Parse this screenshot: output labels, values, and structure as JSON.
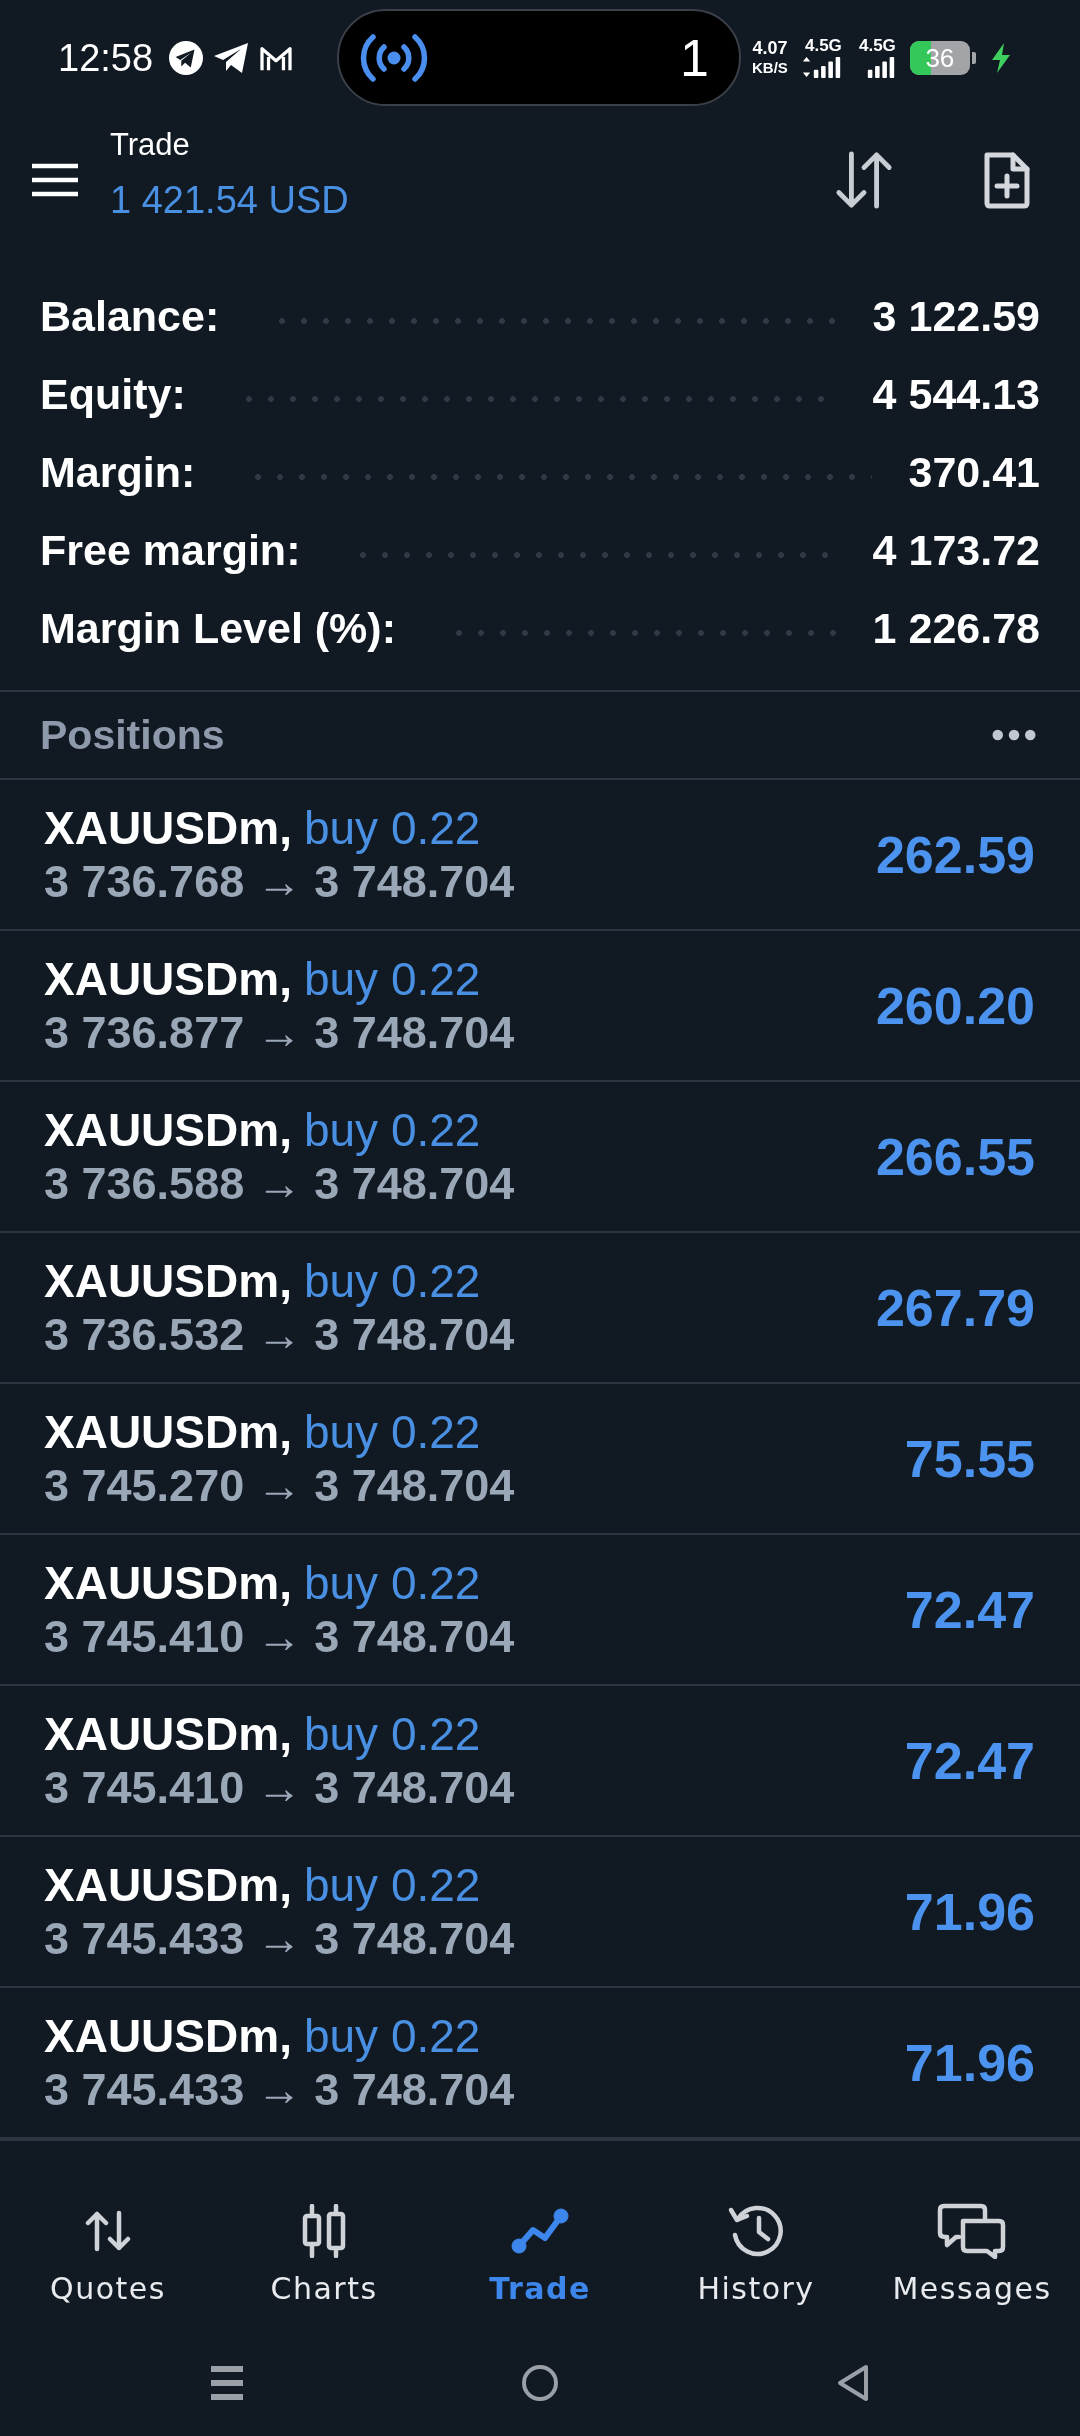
{
  "status_bar": {
    "time": "12:58",
    "island_count": "1",
    "net_speed": "4.07",
    "net_unit": "KB/S",
    "network_labels": [
      "4.5G",
      "4.5G"
    ],
    "battery": "36",
    "charging": true
  },
  "header": {
    "title": "Trade",
    "amount": "1 421.54 USD"
  },
  "account": [
    {
      "label": "Balance:",
      "value": "3 122.59"
    },
    {
      "label": "Equity:",
      "value": "4 544.13"
    },
    {
      "label": "Margin:",
      "value": "370.41"
    },
    {
      "label": "Free margin:",
      "value": "4 173.72"
    },
    {
      "label": "Margin Level (%):",
      "value": "1 226.78"
    }
  ],
  "positions_header": {
    "title": "Positions"
  },
  "positions": [
    {
      "symbol": "XAUUSDm,",
      "order": "buy 0.22",
      "prices": "3 736.768 → 3 748.704",
      "profit": "262.59"
    },
    {
      "symbol": "XAUUSDm,",
      "order": "buy 0.22",
      "prices": "3 736.877 → 3 748.704",
      "profit": "260.20"
    },
    {
      "symbol": "XAUUSDm,",
      "order": "buy 0.22",
      "prices": "3 736.588 → 3 748.704",
      "profit": "266.55"
    },
    {
      "symbol": "XAUUSDm,",
      "order": "buy 0.22",
      "prices": "3 736.532 → 3 748.704",
      "profit": "267.79"
    },
    {
      "symbol": "XAUUSDm,",
      "order": "buy 0.22",
      "prices": "3 745.270 → 3 748.704",
      "profit": "75.55"
    },
    {
      "symbol": "XAUUSDm,",
      "order": "buy 0.22",
      "prices": "3 745.410 → 3 748.704",
      "profit": "72.47"
    },
    {
      "symbol": "XAUUSDm,",
      "order": "buy 0.22",
      "prices": "3 745.410 → 3 748.704",
      "profit": "72.47"
    },
    {
      "symbol": "XAUUSDm,",
      "order": "buy 0.22",
      "prices": "3 745.433 → 3 748.704",
      "profit": "71.96"
    },
    {
      "symbol": "XAUUSDm,",
      "order": "buy 0.22",
      "prices": "3 745.433 → 3 748.704",
      "profit": "71.96"
    }
  ],
  "bottom_nav": [
    {
      "label": "Quotes",
      "selected": false
    },
    {
      "label": "Charts",
      "selected": false
    },
    {
      "label": "Trade",
      "selected": true
    },
    {
      "label": "History",
      "selected": false
    },
    {
      "label": "Messages",
      "selected": false
    }
  ]
}
